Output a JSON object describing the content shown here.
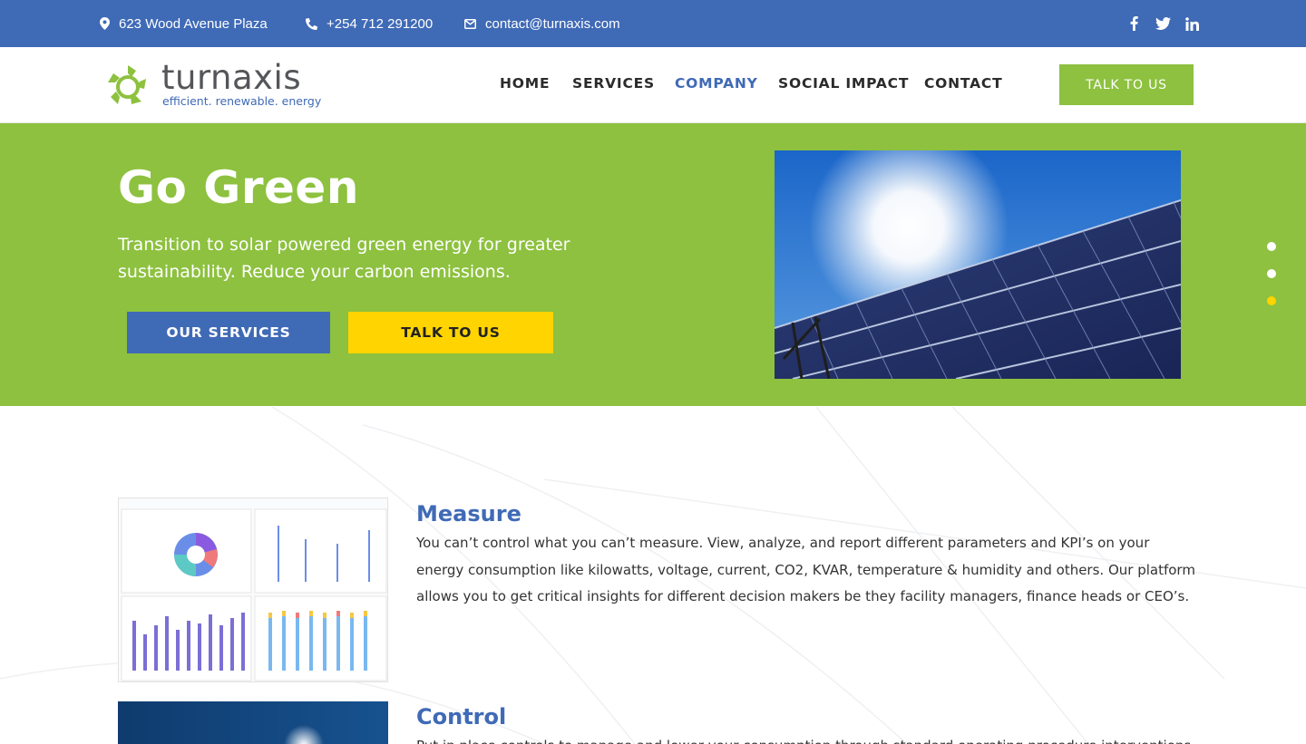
{
  "topbar": {
    "address": "623 Wood Avenue Plaza",
    "phone": "+254 712 291200",
    "email": "contact@turnaxis.com",
    "social": [
      "facebook-icon",
      "twitter-icon",
      "linkedin-icon"
    ]
  },
  "header": {
    "logo_word": "turnaxis",
    "logo_tagline": "efficient. renewable. energy",
    "nav": [
      "HOME",
      "SERVICES",
      "COMPANY",
      "SOCIAL IMPACT",
      "CONTACT"
    ],
    "active_nav": "COMPANY",
    "cta": "TALK TO US"
  },
  "hero": {
    "title": "Go Green",
    "subtitle": "Transition to solar powered green energy for greater sustainability. Reduce your carbon emissions.",
    "primary_button": "OUR SERVICES",
    "secondary_button": "TALK TO US",
    "slide_count": 3,
    "active_slide": 3
  },
  "features": [
    {
      "title": "Measure",
      "text": "You can’t control what you can’t measure. View, analyze, and report different parameters and KPI’s on your energy consumption like kilowatts, voltage, current, CO2, KVAR, temperature & humidity and others. Our platform allows you to get critical insights for different decision makers be they facility managers, finance heads or CEO’s."
    },
    {
      "title": "Control",
      "text": "Put in place controls to manage and lower your consumption through standard operating procedure interventions"
    }
  ],
  "colors": {
    "brand_blue": "#3f6ab6",
    "brand_green": "#8dc13f",
    "accent_yellow": "#ffd400"
  }
}
